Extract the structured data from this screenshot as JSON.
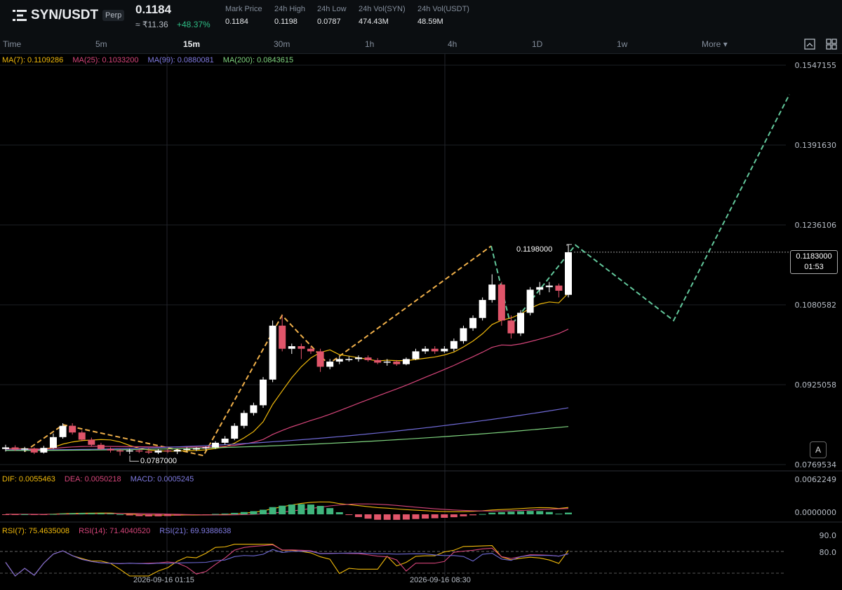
{
  "header": {
    "pair": "SYN/USDT",
    "contract_type": "Perp",
    "last_price": "0.1184",
    "approx_inr": "≈ ₹11.36",
    "change_pct": "+48.37%",
    "stats": [
      {
        "label": "Mark Price",
        "value": "0.1184"
      },
      {
        "label": "24h High",
        "value": "0.1198"
      },
      {
        "label": "24h Low",
        "value": "0.0787"
      },
      {
        "label": "24h Vol(SYN)",
        "value": "474.43M"
      },
      {
        "label": "24h Vol(USDT)",
        "value": "48.59M"
      }
    ]
  },
  "timeframes": [
    "Time",
    "5m",
    "15m",
    "30m",
    "1h",
    "4h",
    "1D",
    "1w",
    "More"
  ],
  "active_timeframe": "15m",
  "ma_legend": {
    "ma7": "MA(7): 0.1109286",
    "ma25": "MA(25): 0.1033200",
    "ma99": "MA(99): 0.0880081",
    "ma200": "MA(200): 0.0843615"
  },
  "price_axis": [
    "0.1547155",
    "0.1391630",
    "0.1236106",
    "0.1080582",
    "0.0925058",
    "0.0769534"
  ],
  "current_price": {
    "value": "0.1183000",
    "countdown": "01:53"
  },
  "annotations": {
    "high": "0.1198000",
    "low": "0.0787000"
  },
  "macd_legend": {
    "dif": "DIF: 0.0055463",
    "dea": "DEA: 0.0050218",
    "macd": "MACD: 0.0005245"
  },
  "macd_axis": [
    "0.0062249",
    "0.0000000"
  ],
  "rsi_legend": {
    "rsi7": "RSI(7): 75.4635008",
    "rsi14": "RSI(14): 71.4040520",
    "rsi21": "RSI(21): 69.9388638"
  },
  "rsi_axis": [
    "90.0",
    "80.0"
  ],
  "time_labels": [
    "2026-09-16 01:15",
    "2026-09-16 08:30"
  ],
  "auto_button": "A",
  "colors": {
    "up": "#ffffff",
    "down": "#e0556a",
    "ma7": "#f0b90b",
    "ma25": "#d6457a",
    "ma99": "#6f6ad6",
    "ma200": "#7fd47f",
    "drawing_orange": "#f0b04a",
    "drawing_green": "#62c79b",
    "macd_pos": "#3fb57c"
  },
  "chart_data": {
    "type": "candlestick",
    "interval": "15m",
    "y_range": [
      0.0769534,
      0.1547155
    ],
    "candles": [
      {
        "o": 0.08,
        "h": 0.0808,
        "l": 0.0795,
        "c": 0.0803
      },
      {
        "o": 0.0803,
        "h": 0.0807,
        "l": 0.0796,
        "c": 0.0799
      },
      {
        "o": 0.0799,
        "h": 0.0804,
        "l": 0.0794,
        "c": 0.0801
      },
      {
        "o": 0.0801,
        "h": 0.0803,
        "l": 0.079,
        "c": 0.0793
      },
      {
        "o": 0.0793,
        "h": 0.0806,
        "l": 0.0791,
        "c": 0.0802
      },
      {
        "o": 0.0802,
        "h": 0.083,
        "l": 0.08,
        "c": 0.0823
      },
      {
        "o": 0.0823,
        "h": 0.085,
        "l": 0.082,
        "c": 0.0845
      },
      {
        "o": 0.0845,
        "h": 0.085,
        "l": 0.0828,
        "c": 0.0832
      },
      {
        "o": 0.0832,
        "h": 0.0836,
        "l": 0.0815,
        "c": 0.0818
      },
      {
        "o": 0.0818,
        "h": 0.0822,
        "l": 0.0805,
        "c": 0.0808
      },
      {
        "o": 0.0808,
        "h": 0.0812,
        "l": 0.0798,
        "c": 0.08
      },
      {
        "o": 0.08,
        "h": 0.0803,
        "l": 0.0793,
        "c": 0.0797
      },
      {
        "o": 0.0797,
        "h": 0.08,
        "l": 0.0787,
        "c": 0.0795
      },
      {
        "o": 0.0795,
        "h": 0.08,
        "l": 0.079,
        "c": 0.0797
      },
      {
        "o": 0.0797,
        "h": 0.08,
        "l": 0.0792,
        "c": 0.0795
      },
      {
        "o": 0.0795,
        "h": 0.0802,
        "l": 0.079,
        "c": 0.0793
      },
      {
        "o": 0.0793,
        "h": 0.08,
        "l": 0.079,
        "c": 0.0797
      },
      {
        "o": 0.0797,
        "h": 0.0801,
        "l": 0.0792,
        "c": 0.0795
      },
      {
        "o": 0.0795,
        "h": 0.08,
        "l": 0.079,
        "c": 0.0798
      },
      {
        "o": 0.0798,
        "h": 0.0803,
        "l": 0.0795,
        "c": 0.08
      },
      {
        "o": 0.08,
        "h": 0.0803,
        "l": 0.0796,
        "c": 0.0801
      },
      {
        "o": 0.0801,
        "h": 0.0805,
        "l": 0.0797,
        "c": 0.0803
      },
      {
        "o": 0.0803,
        "h": 0.0815,
        "l": 0.08,
        "c": 0.0812
      },
      {
        "o": 0.0812,
        "h": 0.0825,
        "l": 0.0808,
        "c": 0.082
      },
      {
        "o": 0.082,
        "h": 0.085,
        "l": 0.0817,
        "c": 0.0845
      },
      {
        "o": 0.0845,
        "h": 0.0875,
        "l": 0.084,
        "c": 0.087
      },
      {
        "o": 0.087,
        "h": 0.089,
        "l": 0.0865,
        "c": 0.0885
      },
      {
        "o": 0.0885,
        "h": 0.094,
        "l": 0.088,
        "c": 0.0935
      },
      {
        "o": 0.0935,
        "h": 0.105,
        "l": 0.093,
        "c": 0.104
      },
      {
        "o": 0.104,
        "h": 0.106,
        "l": 0.099,
        "c": 0.0995
      },
      {
        "o": 0.0995,
        "h": 0.1005,
        "l": 0.0985,
        "c": 0.1
      },
      {
        "o": 0.1,
        "h": 0.1005,
        "l": 0.0975,
        "c": 0.0995
      },
      {
        "o": 0.0995,
        "h": 0.1,
        "l": 0.0985,
        "c": 0.099
      },
      {
        "o": 0.099,
        "h": 0.0995,
        "l": 0.095,
        "c": 0.096
      },
      {
        "o": 0.096,
        "h": 0.0975,
        "l": 0.0955,
        "c": 0.097
      },
      {
        "o": 0.097,
        "h": 0.098,
        "l": 0.0965,
        "c": 0.0975
      },
      {
        "o": 0.0975,
        "h": 0.098,
        "l": 0.097,
        "c": 0.0975
      },
      {
        "o": 0.0975,
        "h": 0.0982,
        "l": 0.097,
        "c": 0.0978
      },
      {
        "o": 0.0978,
        "h": 0.0982,
        "l": 0.097,
        "c": 0.0973
      },
      {
        "o": 0.0973,
        "h": 0.0977,
        "l": 0.0965,
        "c": 0.0968
      },
      {
        "o": 0.0968,
        "h": 0.0975,
        "l": 0.0962,
        "c": 0.097
      },
      {
        "o": 0.097,
        "h": 0.0973,
        "l": 0.0962,
        "c": 0.0965
      },
      {
        "o": 0.0965,
        "h": 0.0978,
        "l": 0.0963,
        "c": 0.0975
      },
      {
        "o": 0.0975,
        "h": 0.0995,
        "l": 0.0973,
        "c": 0.099
      },
      {
        "o": 0.099,
        "h": 0.1,
        "l": 0.0985,
        "c": 0.0995
      },
      {
        "o": 0.0995,
        "h": 0.1,
        "l": 0.0985,
        "c": 0.099
      },
      {
        "o": 0.099,
        "h": 0.1,
        "l": 0.0987,
        "c": 0.0995
      },
      {
        "o": 0.0995,
        "h": 0.1015,
        "l": 0.099,
        "c": 0.101
      },
      {
        "o": 0.101,
        "h": 0.104,
        "l": 0.1005,
        "c": 0.1035
      },
      {
        "o": 0.1035,
        "h": 0.106,
        "l": 0.103,
        "c": 0.1055
      },
      {
        "o": 0.1055,
        "h": 0.1095,
        "l": 0.105,
        "c": 0.109
      },
      {
        "o": 0.109,
        "h": 0.114,
        "l": 0.1085,
        "c": 0.112
      },
      {
        "o": 0.112,
        "h": 0.1125,
        "l": 0.104,
        "c": 0.105
      },
      {
        "o": 0.105,
        "h": 0.106,
        "l": 0.1015,
        "c": 0.1025
      },
      {
        "o": 0.1025,
        "h": 0.107,
        "l": 0.102,
        "c": 0.1065
      },
      {
        "o": 0.1065,
        "h": 0.1115,
        "l": 0.106,
        "c": 0.111
      },
      {
        "o": 0.111,
        "h": 0.1125,
        "l": 0.11,
        "c": 0.1115
      },
      {
        "o": 0.1115,
        "h": 0.1125,
        "l": 0.1105,
        "c": 0.1118
      },
      {
        "o": 0.1118,
        "h": 0.1122,
        "l": 0.1095,
        "c": 0.1108
      },
      {
        "o": 0.11,
        "h": 0.1198,
        "l": 0.1095,
        "c": 0.1183
      }
    ],
    "ma_lines": [
      {
        "name": "MA(7)",
        "last": 0.1109286
      },
      {
        "name": "MA(25)",
        "last": 0.10332
      },
      {
        "name": "MA(99)",
        "last": 0.0880081
      },
      {
        "name": "MA(200)",
        "last": 0.0843615
      }
    ]
  }
}
